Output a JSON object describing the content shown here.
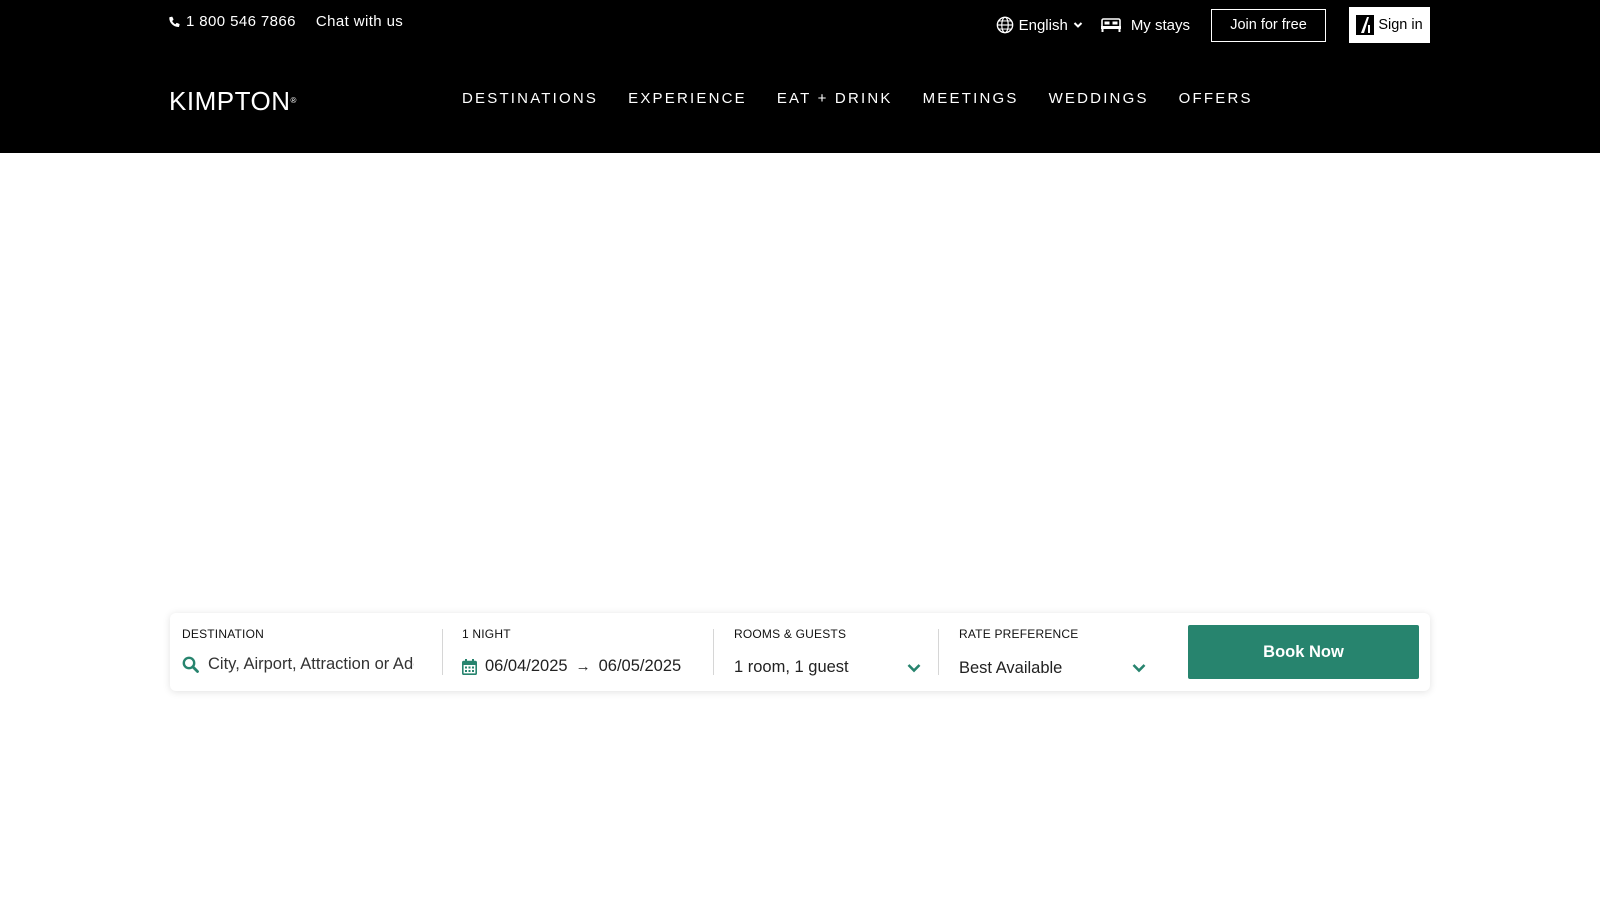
{
  "utility_bar": {
    "phone": "1 800 546 7866",
    "chat": "Chat with us",
    "language": "English",
    "my_stays": "My stays",
    "join": "Join for free",
    "sign_in": "Sign in"
  },
  "brand": {
    "logo_text": "KIMPTON",
    "logo_mark": "®"
  },
  "main_nav": [
    "DESTINATIONS",
    "EXPERIENCE",
    "EAT + DRINK",
    "MEETINGS",
    "WEDDINGS",
    "OFFERS"
  ],
  "booking": {
    "destination_label": "DESTINATION",
    "destination_placeholder": "City, Airport, Attraction or Address",
    "dates_label": "1 NIGHT",
    "check_in": "06/04/2025",
    "arrow": "→",
    "check_out": "06/05/2025",
    "rooms_label": "ROOMS & GUESTS",
    "rooms_value": "1 room, 1 guest",
    "rate_label": "RATE PREFERENCE",
    "rate_value": "Best Available",
    "book_button": "Book Now"
  },
  "colors": {
    "header_bg": "#000000",
    "accent_green": "#27846e"
  },
  "icons": [
    "phone-icon",
    "globe-icon",
    "chevron-down-icon",
    "bed-icon",
    "ihg-logo-icon",
    "search-icon",
    "calendar-icon"
  ]
}
